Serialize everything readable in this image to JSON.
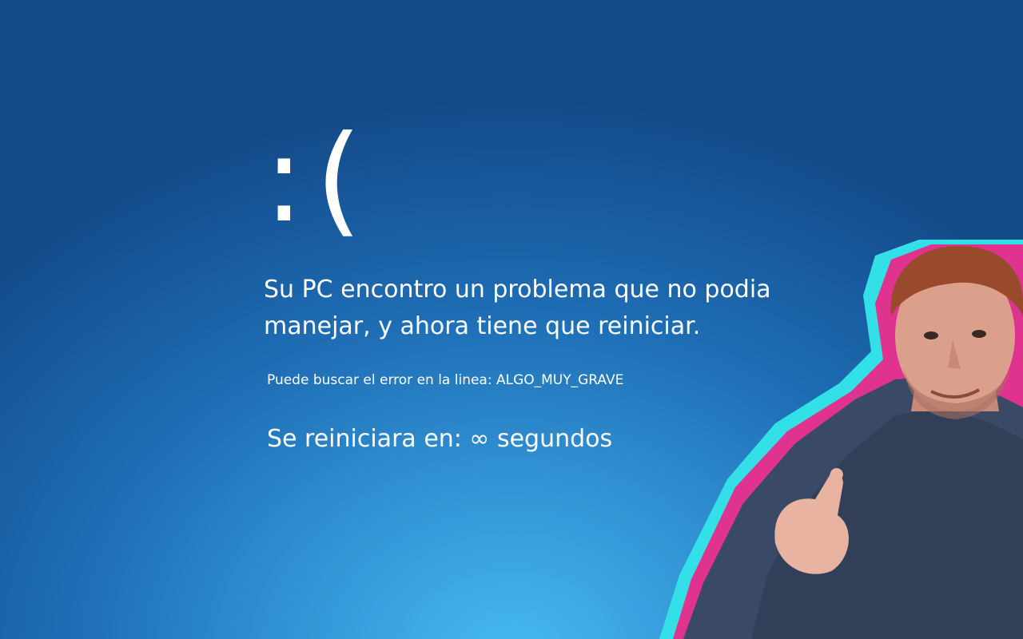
{
  "screen": {
    "emoticon": ":(",
    "message": "Su PC encontro un problema que no podia manejar, y ahora tiene que reiniciar.",
    "error_line": "Puede buscar el error en la linea: ALGO_MUY_GRAVE",
    "restart_text": "Se reiniciara en: ∞ segundos"
  },
  "colors": {
    "background_top": "#134a88",
    "background_bottom_glow": "#46b9f2",
    "text": "#ffffff",
    "outline_cyan": "#33e0e8",
    "outline_magenta": "#e0338f"
  }
}
